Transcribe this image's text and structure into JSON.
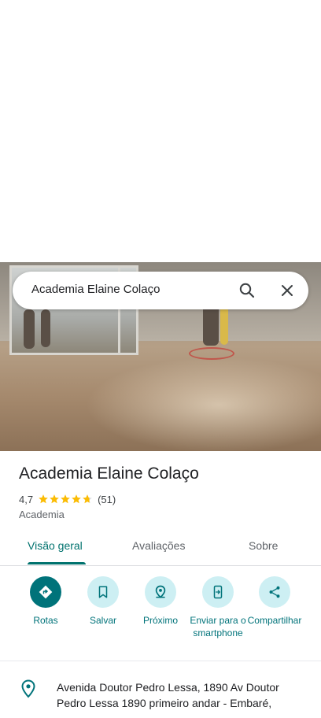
{
  "search": {
    "query": "Academia Elaine Colaço"
  },
  "place": {
    "title": "Academia Elaine Colaço",
    "rating": "4,7",
    "stars": 4.7,
    "review_count": "(51)",
    "category": "Academia"
  },
  "tabs": [
    {
      "label": "Visão geral",
      "active": true
    },
    {
      "label": "Avaliações",
      "active": false
    },
    {
      "label": "Sobre",
      "active": false
    }
  ],
  "actions": [
    {
      "label": "Rotas",
      "icon": "directions-icon"
    },
    {
      "label": "Salvar",
      "icon": "bookmark-icon"
    },
    {
      "label": "Próximo",
      "icon": "nearby-icon"
    },
    {
      "label": "Enviar para o smartphone",
      "icon": "send-to-phone-icon"
    },
    {
      "label": "Compartilhar",
      "icon": "share-icon"
    }
  ],
  "address": {
    "text": "Avenida Doutor Pedro Lessa, 1890 Av Doutor Pedro Lessa 1890 primeiro andar - Embaré,"
  },
  "colors": {
    "accent": "#00737a",
    "star": "#fbbc04",
    "action_bg": "#cdeff3"
  }
}
